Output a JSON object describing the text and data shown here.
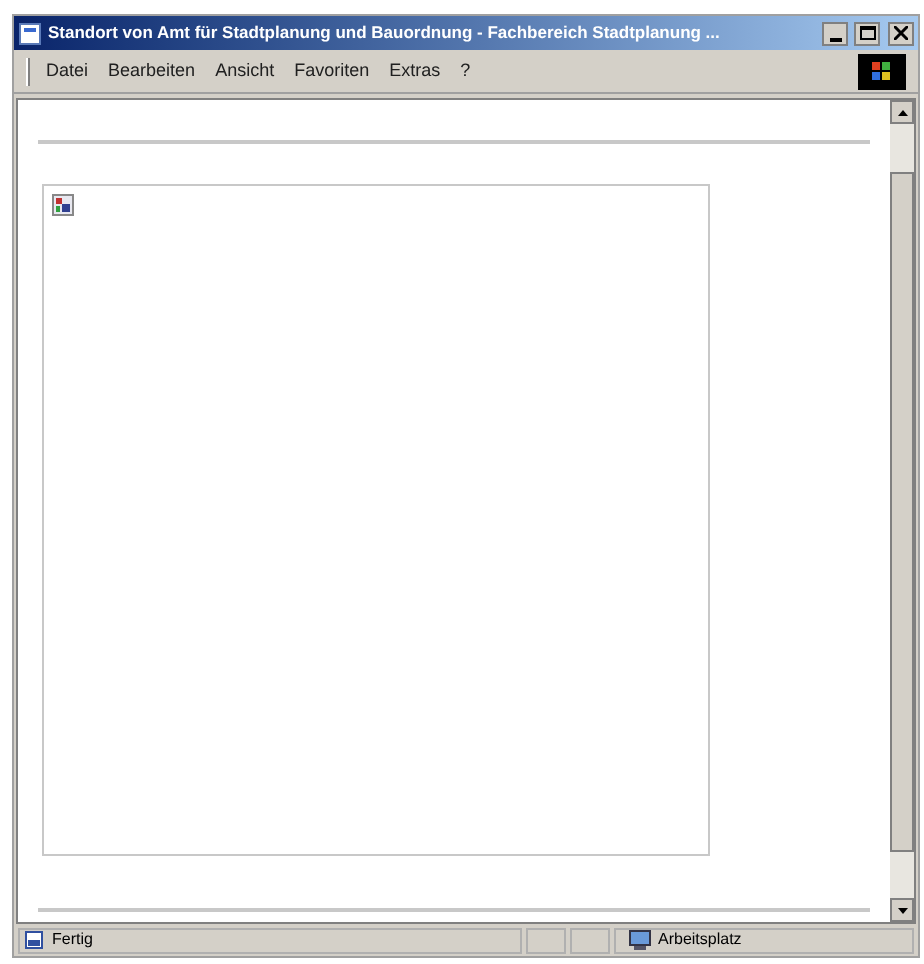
{
  "window": {
    "title": "Standort von Amt für Stadtplanung und Bauordnung - Fachbereich Stadtplanung ..."
  },
  "menu": [
    "Datei",
    "Bearbeiten",
    "Ansicht",
    "Favoriten",
    "Extras",
    "?"
  ],
  "status_bar": {
    "status": "Fertig",
    "zone": "Arbeitsplatz"
  }
}
